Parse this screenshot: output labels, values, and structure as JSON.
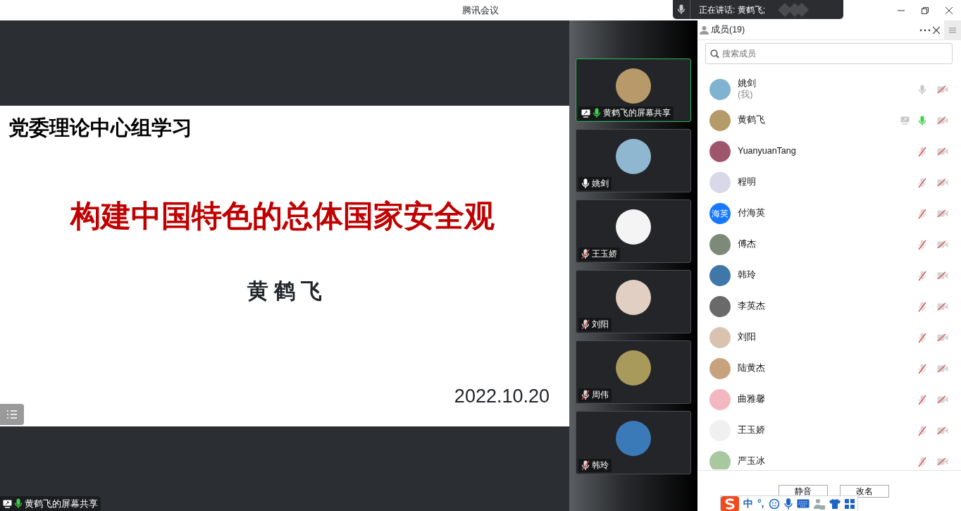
{
  "window": {
    "title": "腾讯会议"
  },
  "speaking_toast": {
    "text": "正在讲话: 黄鹤飞;"
  },
  "slide": {
    "title": "党委理论中心组学习",
    "heading": "构建中国特色的总体国家安全观",
    "presenter": "黄 鹤 飞",
    "date": "2022.10.20"
  },
  "share_label": {
    "text": "黄鹤飞的屏幕共享",
    "sharing": true,
    "muted": false,
    "speaking": true
  },
  "tiles": [
    {
      "name": "黄鹤飞的屏幕共享",
      "muted": false,
      "speaking": true,
      "sharing": true,
      "active": true
    },
    {
      "name": "姚剑",
      "muted": false,
      "speaking": false,
      "sharing": false,
      "active": false
    },
    {
      "name": "王玉娇",
      "muted": true,
      "speaking": false,
      "sharing": false,
      "active": false
    },
    {
      "name": "刘阳",
      "muted": true,
      "speaking": false,
      "sharing": false,
      "active": false
    },
    {
      "name": "周伟",
      "muted": true,
      "speaking": false,
      "sharing": false,
      "active": false
    },
    {
      "name": "韩玲",
      "muted": true,
      "speaking": false,
      "sharing": false,
      "active": false
    }
  ],
  "panel": {
    "title": "成员(19)",
    "search_placeholder": "搜索成员"
  },
  "members": [
    {
      "name": "姚剑",
      "note": "(我)",
      "muted": false,
      "speaking": false,
      "sharing": false,
      "camera_on": false
    },
    {
      "name": "黄鹤飞",
      "muted": false,
      "speaking": true,
      "sharing": true,
      "camera_on": false
    },
    {
      "name": "YuanyuanTang",
      "muted": true,
      "speaking": false,
      "sharing": false,
      "camera_on": false
    },
    {
      "name": "程明",
      "muted": true,
      "speaking": false,
      "sharing": false,
      "camera_on": false
    },
    {
      "name": "付海英",
      "avatar_text": "海英",
      "muted": true,
      "speaking": false,
      "sharing": false,
      "camera_on": false
    },
    {
      "name": "傅杰",
      "muted": true,
      "speaking": false,
      "sharing": false,
      "camera_on": false
    },
    {
      "name": "韩玲",
      "muted": true,
      "speaking": false,
      "sharing": false,
      "camera_on": false
    },
    {
      "name": "李英杰",
      "muted": true,
      "speaking": false,
      "sharing": false,
      "camera_on": false
    },
    {
      "name": "刘阳",
      "muted": true,
      "speaking": false,
      "sharing": false,
      "camera_on": false
    },
    {
      "name": "陆黄杰",
      "muted": true,
      "speaking": false,
      "sharing": false,
      "camera_on": false
    },
    {
      "name": "曲雅馨",
      "muted": true,
      "speaking": false,
      "sharing": false,
      "camera_on": false
    },
    {
      "name": "王玉娇",
      "muted": true,
      "speaking": false,
      "sharing": false,
      "camera_on": false
    },
    {
      "name": "严玉冰",
      "muted": true,
      "speaking": false,
      "sharing": false,
      "camera_on": false
    }
  ],
  "footer": {
    "buttons": [
      "静音",
      "改名"
    ]
  },
  "ime": {
    "mode": "中",
    "punct": "°,"
  }
}
